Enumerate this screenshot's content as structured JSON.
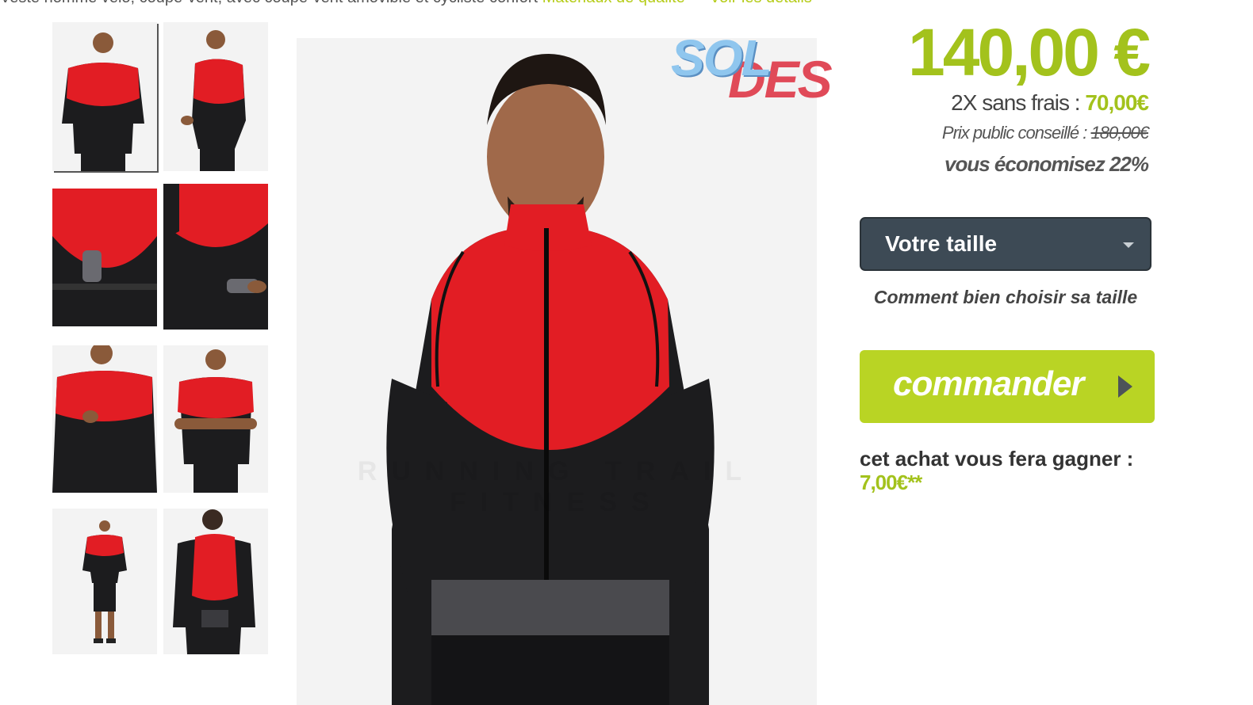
{
  "breadcrumb": {
    "text": "Veste homme vélo, coupe-vent, avec coupe-vent amovible et cycliste confort",
    "highlight": "Matériaux de qualité — Voir les détails"
  },
  "badge": {
    "part1": "SOL",
    "part2": "DES"
  },
  "price": {
    "main": "140,00 €",
    "installments_label": "2X sans frais : ",
    "installments_value": "70,00€",
    "public_price_label": "Prix public conseillé : ",
    "public_price_value": "180,00€",
    "savings": "vous économisez 22%"
  },
  "size_select": {
    "label": "Votre taille"
  },
  "size_guide": "Comment bien choisir sa taille",
  "order_button": {
    "label": "commander"
  },
  "loyalty": {
    "label": "cet achat vous fera gagner :",
    "value": "7,00€**"
  },
  "main_image": {
    "watermark": "RUNNING TRAIL FITNESS"
  },
  "colors": {
    "accent": "#a3c21c",
    "button": "#b9d424",
    "select_bg": "#3d4a55",
    "jacket_red": "#e21d24",
    "jacket_black": "#1c1c1e"
  }
}
